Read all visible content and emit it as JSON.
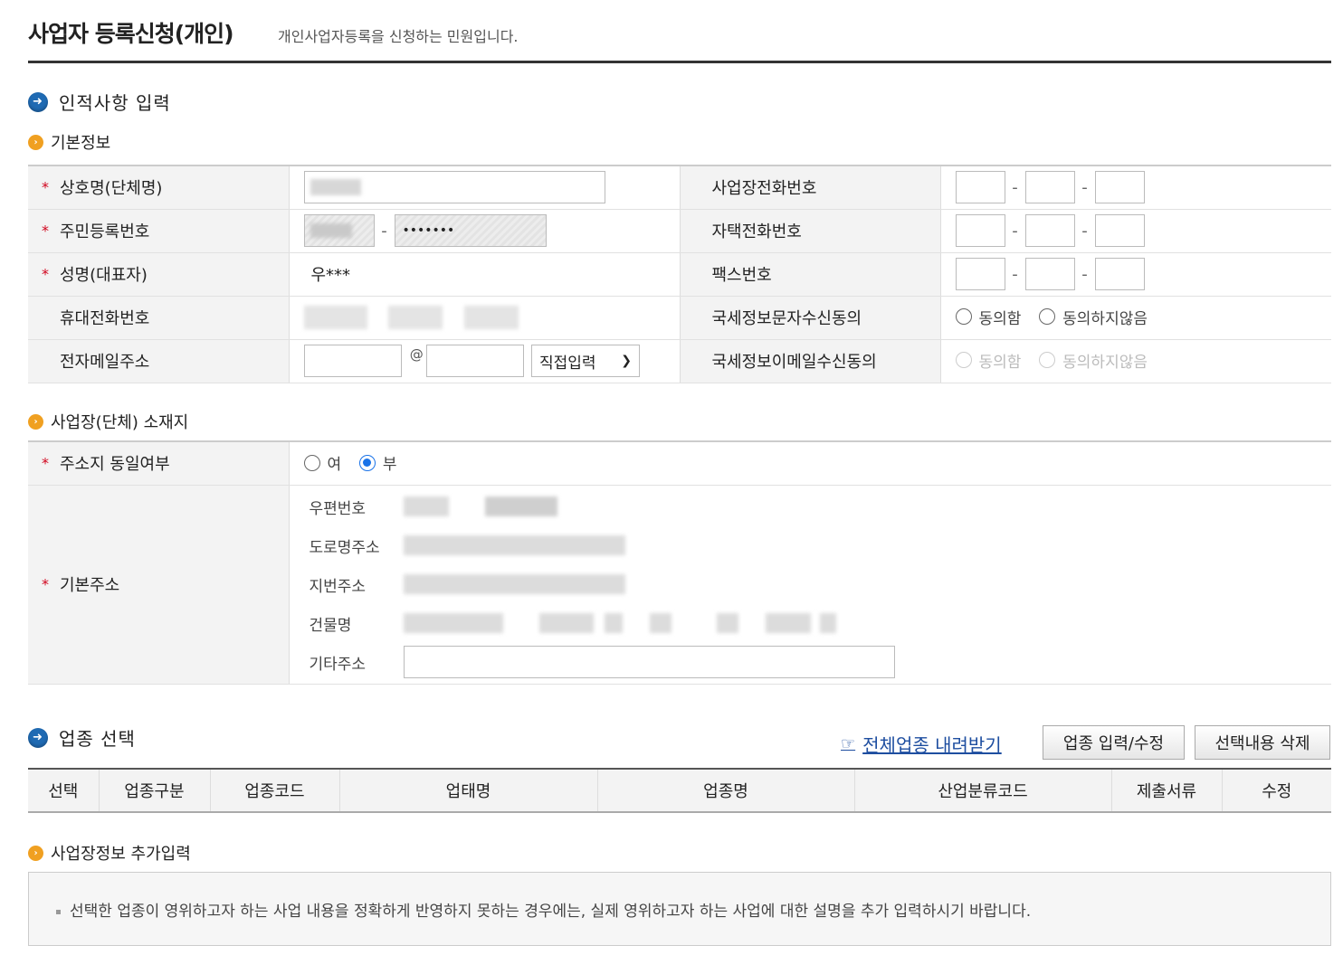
{
  "header": {
    "title": "사업자 등록신청(개인)",
    "description": "개인사업자등록을 신청하는 민원입니다."
  },
  "personal": {
    "section_title": "인적사항 입력",
    "basic_title": "기본정보",
    "labels": {
      "company_name": "상호명(단체명)",
      "resident_no": "주민등록번호",
      "name": "성명(대표자)",
      "mobile": "휴대전화번호",
      "email": "전자메일주소",
      "biz_phone": "사업장전화번호",
      "home_phone": "자택전화번호",
      "fax": "팩스번호",
      "sms_consent": "국세정보문자수신동의",
      "email_consent": "국세정보이메일수신동의"
    },
    "required_mark": "*",
    "resident_no_back": "•••••••",
    "name_value": "우***",
    "email_at": "@",
    "email_domain_select": "직접입력",
    "phone_dash": "-",
    "consent_yes": "동의함",
    "consent_no": "동의하지않음"
  },
  "location": {
    "title": "사업장(단체) 소재지",
    "same_address_label": "주소지 동일여부",
    "same_yes": "여",
    "same_no": "부",
    "selected": "부",
    "base_address_label": "기본주소",
    "rows": {
      "postal": "우편번호",
      "road": "도로명주소",
      "lot": "지번주소",
      "building": "건물명",
      "etc": "기타주소"
    }
  },
  "industry": {
    "title": "업종 선택",
    "download_link": "전체업종 내려받기",
    "edit_button": "업종 입력/수정",
    "delete_button": "선택내용 삭제",
    "columns": [
      "선택",
      "업종구분",
      "업종코드",
      "업태명",
      "업종명",
      "산업분류코드",
      "제출서류",
      "수정"
    ]
  },
  "extra": {
    "title": "사업장정보 추가입력",
    "notice": "선택한 업종이 영위하고자 하는 사업 내용을 정확하게 반영하지 못하는 경우에는, 실제 영위하고자 하는 사업에 대한 설명을 추가 입력하시기 바랍니다."
  },
  "icons": {
    "section_bullet": "arrow-right-circle-icon",
    "sub_bullet": "chevron-right-circle-icon",
    "link_icon": "pointing-hand-icon",
    "select_arrow": "chevron-down-icon"
  },
  "colors": {
    "accent_blue": "#1f6ab3",
    "bullet_orange": "#f0a021",
    "required_red": "#d0021b",
    "link_blue": "#1e4ea0",
    "radio_blue": "#1a73e8"
  }
}
